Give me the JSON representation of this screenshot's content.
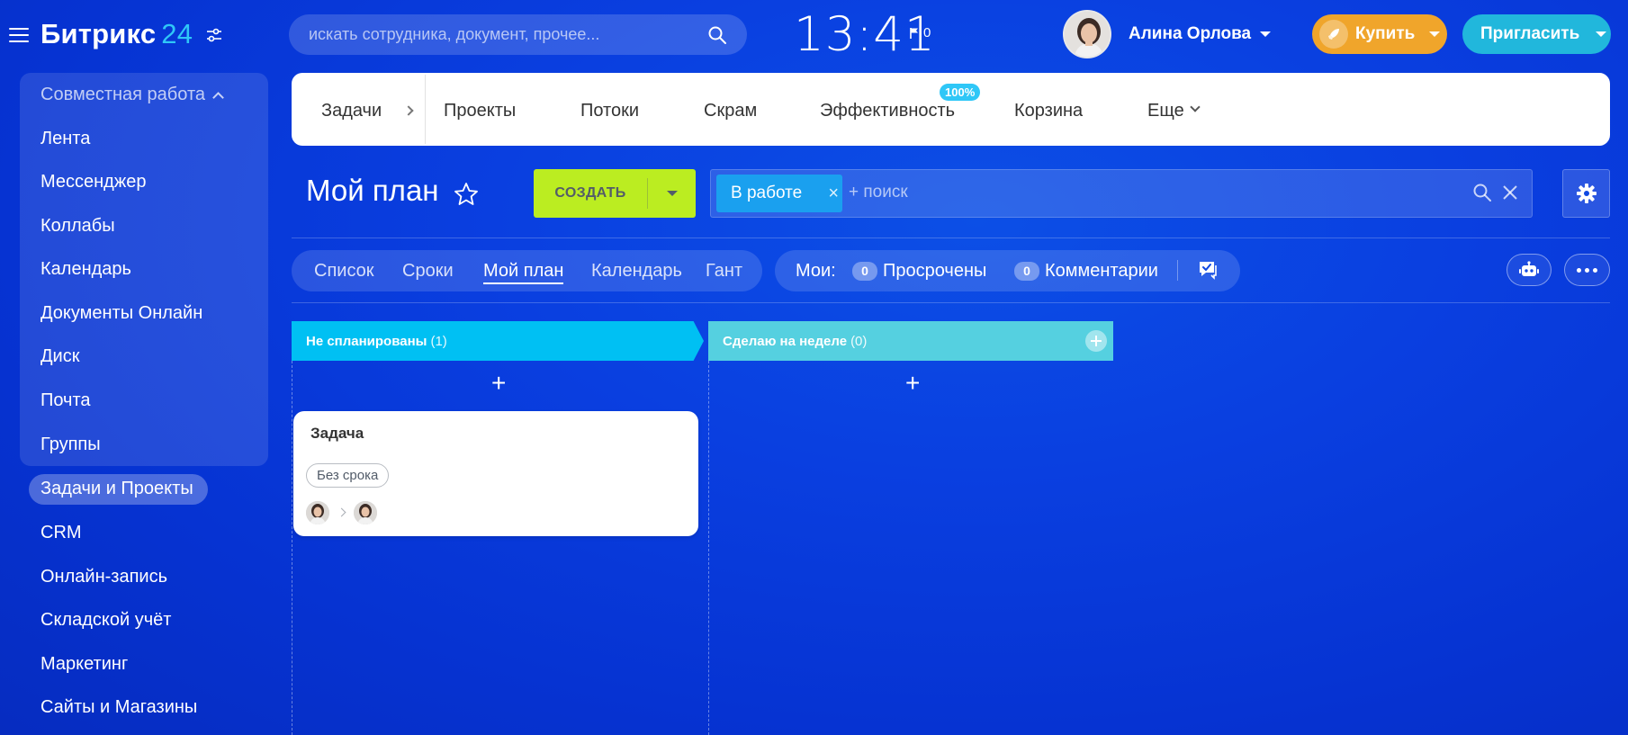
{
  "header": {
    "logo_name": "Битрикс",
    "logo_number": "24",
    "search_placeholder": "искать сотрудника, документ, прочее...",
    "clock": "13:41",
    "flag_count": "0",
    "user_name": "Алина Орлова",
    "buy_label": "Купить",
    "invite_label": "Пригласить"
  },
  "sidebar": {
    "group_header": "Совместная работа",
    "items": [
      {
        "label": "Лента"
      },
      {
        "label": "Мессенджер"
      },
      {
        "label": "Коллабы"
      },
      {
        "label": "Календарь"
      },
      {
        "label": "Документы Онлайн"
      },
      {
        "label": "Диск"
      },
      {
        "label": "Почта"
      },
      {
        "label": "Группы"
      },
      {
        "label": "Задачи и Проекты",
        "active": true
      },
      {
        "label": "CRM"
      },
      {
        "label": "Онлайн-запись"
      },
      {
        "label": "Складской учёт"
      },
      {
        "label": "Маркетинг"
      },
      {
        "label": "Сайты и Магазины"
      }
    ]
  },
  "topnav": {
    "items": [
      {
        "label": "Задачи"
      },
      {
        "label": "Проекты"
      },
      {
        "label": "Потоки"
      },
      {
        "label": "Скрам"
      },
      {
        "label": "Эффективность",
        "badge": "100%"
      },
      {
        "label": "Корзина"
      },
      {
        "label": "Еще"
      }
    ]
  },
  "page": {
    "title": "Мой план",
    "create_label": "СОЗДАТЬ",
    "filter_chip": "В работе",
    "filter_placeholder": "+ поиск"
  },
  "view_tabs": [
    {
      "label": "Список"
    },
    {
      "label": "Сроки"
    },
    {
      "label": "Мой план",
      "active": true
    },
    {
      "label": "Календарь"
    },
    {
      "label": "Гант"
    }
  ],
  "counters": {
    "label": "Мои:",
    "overdue_count": "0",
    "overdue_label": "Просрочены",
    "comments_count": "0",
    "comments_label": "Комментарии"
  },
  "kanban": {
    "columns": [
      {
        "title": "Не спланированы",
        "count": "(1)",
        "color": "#00c0f3"
      },
      {
        "title": "Сделаю на неделе",
        "count": "(0)",
        "color": "#55d0e0"
      }
    ],
    "card": {
      "title": "Задача",
      "deadline": "Без срока"
    }
  },
  "colors": {
    "background": "#0a3fe0",
    "accent_green": "#bbed21",
    "buy_orange": "#f0a52b",
    "invite_teal": "#21b7dc",
    "chip_blue": "#1aa0ef"
  }
}
